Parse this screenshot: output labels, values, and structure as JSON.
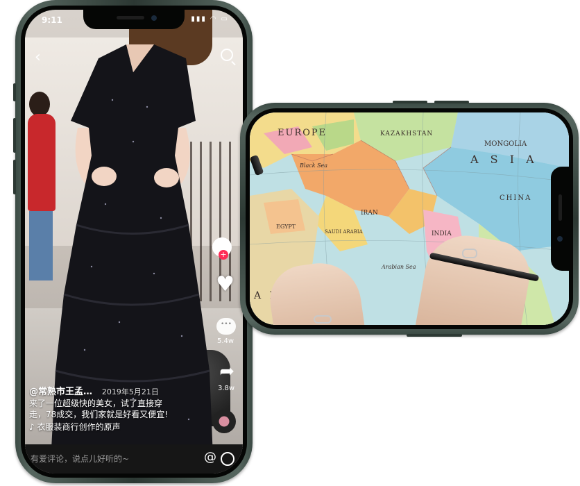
{
  "portrait_phone": {
    "status_bar": {
      "time": "9:11",
      "icons": "▮▮▮ ◠ ▭"
    },
    "video": {
      "username": "@常熟市王孟…",
      "date": "2019年5月21日",
      "caption_line1": "来了一位超级快的美女，试了直接穿",
      "caption_line2": "走，78成交，我们家就是好看又便宜!",
      "music": "♪ 衣服装商行创作的原声"
    },
    "rail": {
      "comment_count": "5.4w",
      "share_count": "3.8w"
    },
    "comment_bar": {
      "placeholder": "有爱评论，说点儿好听的~",
      "at_symbol": "@"
    },
    "back_glyph": "‹",
    "heart_glyph": "♥",
    "share_glyph": "➦",
    "follow_plus": "+"
  },
  "landscape_phone": {
    "map_labels": {
      "europe": "EUROPE",
      "kazakhstan": "KAZAKHSTAN",
      "mongolia": "MONGOLIA",
      "asia": "A S I A",
      "china": "CHINA",
      "black_sea": "Black Sea",
      "iran": "IRAN",
      "saudi_arabia": "SAUDI ARABIA",
      "egypt": "EGYPT",
      "arabian_sea": "Arabian Sea",
      "africa": "A F R I",
      "india": "INDIA"
    }
  },
  "colors": {
    "frame": "#3b4a44",
    "tiktok_red": "#fe2c55"
  }
}
